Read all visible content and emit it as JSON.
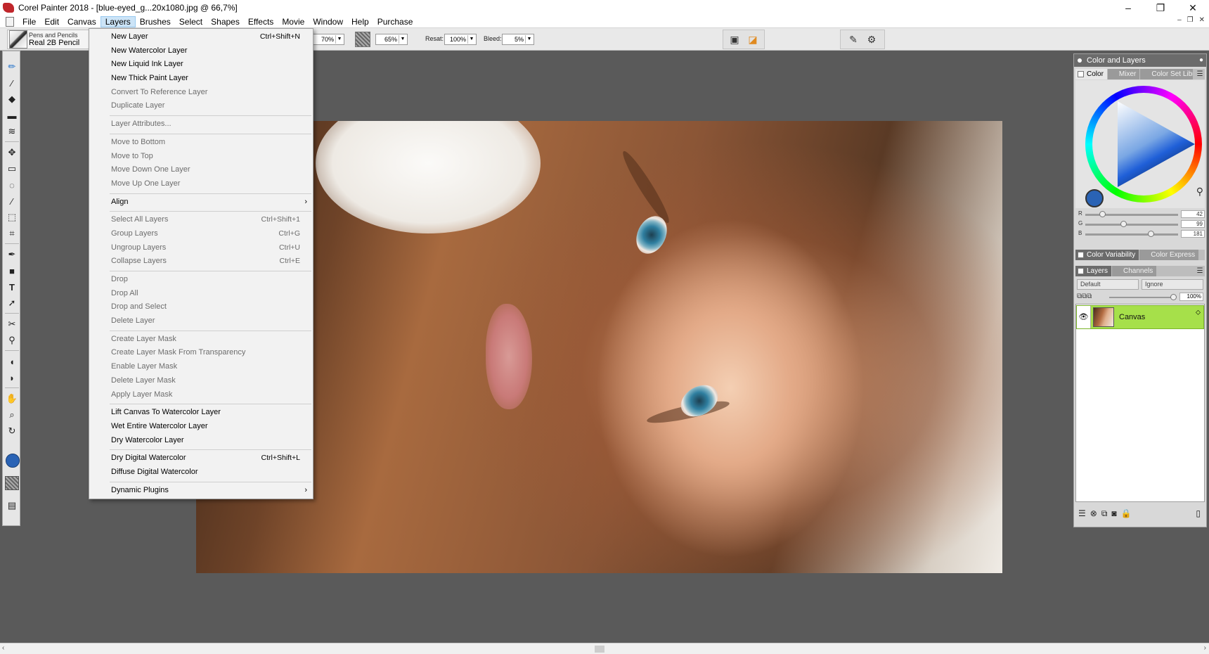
{
  "window": {
    "title": "Corel Painter 2018 - [blue-eyed_g...20x1080.jpg @ 66,7%]",
    "controls": [
      "–",
      "❐",
      "✕"
    ]
  },
  "menubar": {
    "items": [
      "File",
      "Edit",
      "Canvas",
      "Layers",
      "Brushes",
      "Select",
      "Shapes",
      "Effects",
      "Movie",
      "Window",
      "Help",
      "Purchase"
    ],
    "active": "Layers",
    "mdi_controls": [
      "–",
      "❐",
      "✕"
    ]
  },
  "propbar": {
    "brush_category": "Pens and Pencils",
    "brush_variant": "Real 2B Pencil",
    "opacity_value": "70%",
    "grain_value": "65%",
    "resat_label": "Resat:",
    "resat_value": "100%",
    "bleed_label": "Bleed:",
    "bleed_value": "5%"
  },
  "layers_menu": {
    "items": [
      {
        "label": "New Layer",
        "shortcut": "Ctrl+Shift+N",
        "enabled": true
      },
      {
        "label": "New Watercolor Layer",
        "shortcut": "",
        "enabled": true
      },
      {
        "label": "New Liquid Ink Layer",
        "shortcut": "",
        "enabled": true
      },
      {
        "label": "New Thick Paint Layer",
        "shortcut": "",
        "enabled": true
      },
      {
        "label": "Convert To Reference Layer",
        "shortcut": "",
        "enabled": false
      },
      {
        "label": "Duplicate Layer",
        "shortcut": "",
        "enabled": false
      },
      {
        "label": "Layer Attributes...",
        "shortcut": "",
        "enabled": false
      },
      {
        "label": "Move to Bottom",
        "shortcut": "",
        "enabled": false
      },
      {
        "label": "Move to Top",
        "shortcut": "",
        "enabled": false
      },
      {
        "label": "Move Down One Layer",
        "shortcut": "",
        "enabled": false
      },
      {
        "label": "Move Up One Layer",
        "shortcut": "",
        "enabled": false
      },
      {
        "label": "Align",
        "shortcut": "",
        "enabled": true,
        "submenu": true
      },
      {
        "label": "Select All Layers",
        "shortcut": "Ctrl+Shift+1",
        "enabled": false
      },
      {
        "label": "Group Layers",
        "shortcut": "Ctrl+G",
        "enabled": false
      },
      {
        "label": "Ungroup Layers",
        "shortcut": "Ctrl+U",
        "enabled": false
      },
      {
        "label": "Collapse Layers",
        "shortcut": "Ctrl+E",
        "enabled": false
      },
      {
        "label": "Drop",
        "shortcut": "",
        "enabled": false
      },
      {
        "label": "Drop All",
        "shortcut": "",
        "enabled": false
      },
      {
        "label": "Drop and Select",
        "shortcut": "",
        "enabled": false
      },
      {
        "label": "Delete Layer",
        "shortcut": "",
        "enabled": false
      },
      {
        "label": "Create Layer Mask",
        "shortcut": "",
        "enabled": false
      },
      {
        "label": "Create Layer Mask From Transparency",
        "shortcut": "",
        "enabled": false
      },
      {
        "label": "Enable Layer Mask",
        "shortcut": "",
        "enabled": false
      },
      {
        "label": "Delete Layer Mask",
        "shortcut": "",
        "enabled": false
      },
      {
        "label": "Apply Layer Mask",
        "shortcut": "",
        "enabled": false
      },
      {
        "label": "Lift Canvas To Watercolor Layer",
        "shortcut": "",
        "enabled": true
      },
      {
        "label": "Wet Entire Watercolor Layer",
        "shortcut": "",
        "enabled": true
      },
      {
        "label": "Dry Watercolor Layer",
        "shortcut": "",
        "enabled": true
      },
      {
        "label": "Dry Digital Watercolor",
        "shortcut": "Ctrl+Shift+L",
        "enabled": true
      },
      {
        "label": "Diffuse Digital Watercolor",
        "shortcut": "",
        "enabled": true
      },
      {
        "label": "Dynamic Plugins",
        "shortcut": "",
        "enabled": true,
        "submenu": true
      }
    ]
  },
  "panel": {
    "title": "Color and Layers",
    "color_tabs": [
      "Color",
      "Mixer",
      "Color Set Libraries"
    ],
    "current_color": "#2a63b5",
    "rgb": [
      {
        "label": "R",
        "value": "42",
        "level": 0.165
      },
      {
        "label": "G",
        "value": "99",
        "level": 0.388
      },
      {
        "label": "B",
        "value": "181",
        "level": 0.71
      }
    ],
    "variability_tabs": [
      "Color Variability",
      "Color Express"
    ],
    "layer_tabs": [
      "Layers",
      "Channels"
    ],
    "composite_method": "Default",
    "preserve": "Ignore",
    "opacity": "100%",
    "layers": [
      {
        "name": "Canvas",
        "selected": true
      }
    ]
  },
  "icons": {
    "toolbox": [
      "brush-icon",
      "dropper-icon",
      "paint-bucket-icon",
      "eraser-icon",
      "blender-icon",
      "move-icon",
      "rect-select-icon",
      "lasso-icon",
      "magic-wand-icon",
      "transform-icon",
      "crop-icon",
      "pen-icon",
      "shape-icon",
      "text-icon",
      "selection-adjuster-icon",
      "cloner-icon",
      "stamp-icon",
      "dodge-icon",
      "burn-icon",
      "grabber-icon",
      "magnifier-icon",
      "rotate-page-icon"
    ]
  }
}
